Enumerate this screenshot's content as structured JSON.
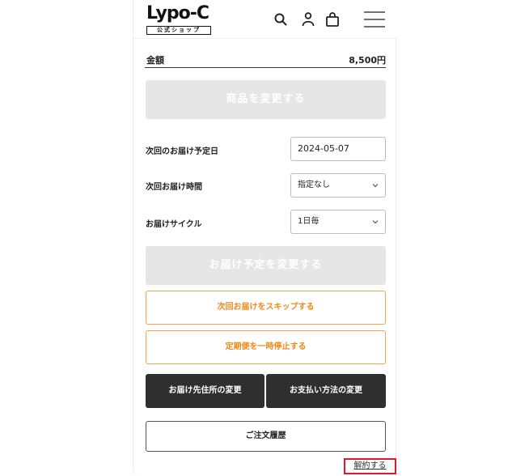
{
  "header": {
    "logo_text": "Lypo-C",
    "logo_sub": "公式ショップ",
    "icons": [
      "search-icon",
      "user-icon",
      "bag-icon",
      "menu-icon"
    ]
  },
  "amount": {
    "label": "金額",
    "value": "8,500円"
  },
  "change_product_button": "商品を変更する",
  "next_delivery_date": {
    "label": "次回のお届け予定日",
    "value": "2024-05-07"
  },
  "next_delivery_time": {
    "label": "次回お届け時間",
    "value": "指定なし"
  },
  "delivery_cycle": {
    "label": "お届けサイクル",
    "value": "1日毎"
  },
  "change_schedule_button": "お届け予定を変更する",
  "skip_button": "次回お届けをスキップする",
  "pause_button": "定期便を一時停止する",
  "change_address_button": "お届け先住所の変更",
  "change_payment_button": "お支払い方法の変更",
  "order_history_button": "ご注文履歴",
  "cancel_link": "解約する",
  "colors": {
    "accent": "#f08a1c",
    "dark_button": "#2f2f2f",
    "disabled_button": "#e6e6e6",
    "highlight": "#e0162b"
  }
}
